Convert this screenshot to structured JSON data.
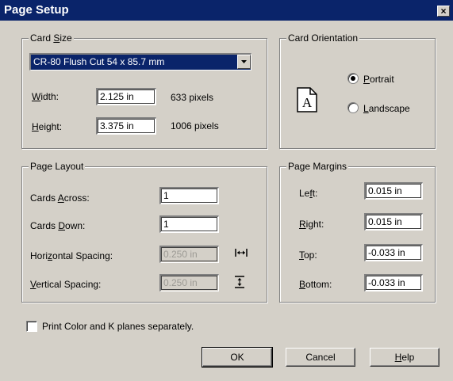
{
  "window": {
    "title": "Page Setup",
    "close_glyph": "×"
  },
  "card_size": {
    "legend_pre": "Card ",
    "legend_u": "S",
    "legend_post": "ize",
    "selected": "CR-80 Flush Cut 54 x 85.7 mm",
    "width_u": "W",
    "width_rest": "idth:",
    "width_value": "2.125 in",
    "width_pixels": "633 pixels",
    "height_u": "H",
    "height_rest": "eight:",
    "height_value": "3.375 in",
    "height_pixels": "1006 pixels"
  },
  "card_orientation": {
    "legend": "Card Orientation",
    "icon_letter": "A",
    "portrait_u": "P",
    "portrait_rest": "ortrait",
    "portrait_selected": true,
    "landscape_u": "L",
    "landscape_rest": "andscape",
    "landscape_selected": false
  },
  "page_layout": {
    "legend": "Page Layout",
    "across_pre": "Cards ",
    "across_u": "A",
    "across_post": "cross:",
    "across_value": "1",
    "down_pre": "Cards ",
    "down_u": "D",
    "down_post": "own:",
    "down_value": "1",
    "hspace_pre": "Hori",
    "hspace_u": "z",
    "hspace_post": "ontal Spacing:",
    "hspace_value": "0.250 in",
    "vspace_u": "V",
    "vspace_post": "ertical Spacing:",
    "vspace_value": "0.250 in"
  },
  "page_margins": {
    "legend": "Page Margins",
    "left_pre": "Le",
    "left_u": "f",
    "left_post": "t:",
    "left_value": "0.015 in",
    "right_u": "R",
    "right_post": "ight:",
    "right_value": "0.015 in",
    "top_u": "T",
    "top_post": "op:",
    "top_value": "-0.033 in",
    "bottom_u": "B",
    "bottom_post": "ottom:",
    "bottom_value": "-0.033 in"
  },
  "options": {
    "print_separately_label": "Print Color and K planes separately.",
    "print_separately_checked": false
  },
  "buttons": {
    "ok": "OK",
    "cancel": "Cancel",
    "help_u": "H",
    "help_rest": "elp"
  }
}
